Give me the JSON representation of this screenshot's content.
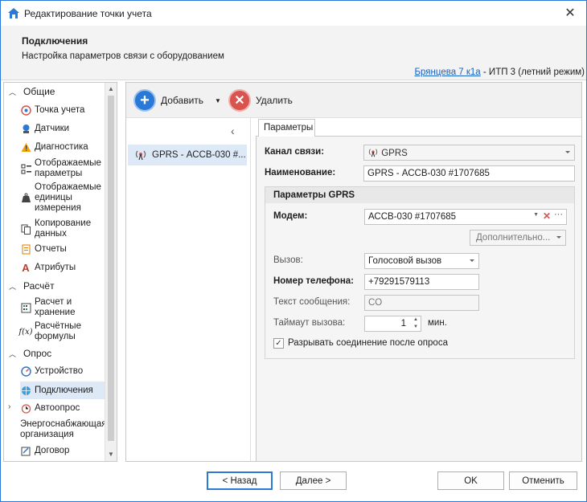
{
  "window": {
    "title": "Редактирование точки учета",
    "close_glyph": "✕"
  },
  "header": {
    "title": "Подключения",
    "subtitle": "Настройка параметров связи с оборудованием",
    "address_link": "Брянцева 7 к1а",
    "address_suffix": " - ИТП 3 (летний режим)"
  },
  "nav": {
    "groups": [
      {
        "label": "Общие",
        "items": [
          {
            "label": "Точка учета",
            "icon": "target-icon"
          },
          {
            "label": "Датчики",
            "icon": "sensor-icon"
          },
          {
            "label": "Диагностика",
            "icon": "warning-icon"
          },
          {
            "label": "Отображаемые параметры",
            "icon": "list-check-icon"
          },
          {
            "label": "Отображаемые единицы измерения",
            "icon": "weight-icon"
          },
          {
            "label": "Копирование данных",
            "icon": "copy-icon"
          },
          {
            "label": "Отчеты",
            "icon": "report-icon"
          },
          {
            "label": "Атрибуты",
            "icon": "attribute-icon"
          }
        ]
      },
      {
        "label": "Расчёт",
        "items": [
          {
            "label": "Расчет и хранение",
            "icon": "calc-icon"
          },
          {
            "label": "Расчётные формулы",
            "icon": "formula-icon"
          }
        ]
      },
      {
        "label": "Опрос",
        "items": [
          {
            "label": "Устройство",
            "icon": "gauge-icon"
          },
          {
            "label": "Подключения",
            "icon": "globe-icon"
          },
          {
            "label": "Автоопрос",
            "icon": "clock-icon"
          }
        ]
      },
      {
        "label": "Энергоснабжающая организация",
        "items": [
          {
            "label": "Договор",
            "icon": "contract-icon"
          }
        ]
      }
    ]
  },
  "toolbar": {
    "add_label": "Добавить",
    "delete_label": "Удалить"
  },
  "connections": {
    "items": [
      "GPRS - АССВ-030 #..."
    ],
    "collapse_glyph": "‹"
  },
  "tabs": {
    "params": "Параметры"
  },
  "form": {
    "channel_label": "Канал связи:",
    "channel_value": "GPRS",
    "name_label": "Наименование:",
    "name_value": "GPRS - АССВ-030 #1707685",
    "gprs_header": "Параметры GPRS",
    "modem_label": "Модем:",
    "modem_value": "АССВ-030 #1707685",
    "more_button": "Дополнительно...",
    "call_label": "Вызов:",
    "call_value": "Голосовой вызов",
    "phone_label": "Номер телефона:",
    "phone_value": "+79291579113",
    "message_label": "Текст сообщения:",
    "message_value": "CO",
    "timeout_label": "Таймаут вызова:",
    "timeout_value": "1",
    "timeout_unit": "мин.",
    "disconnect_label": "Разрывать соединение после опроса",
    "disconnect_checked": true
  },
  "footer": {
    "back": "< Назад",
    "next": "Далее >",
    "ok": "OK",
    "cancel": "Отменить"
  }
}
